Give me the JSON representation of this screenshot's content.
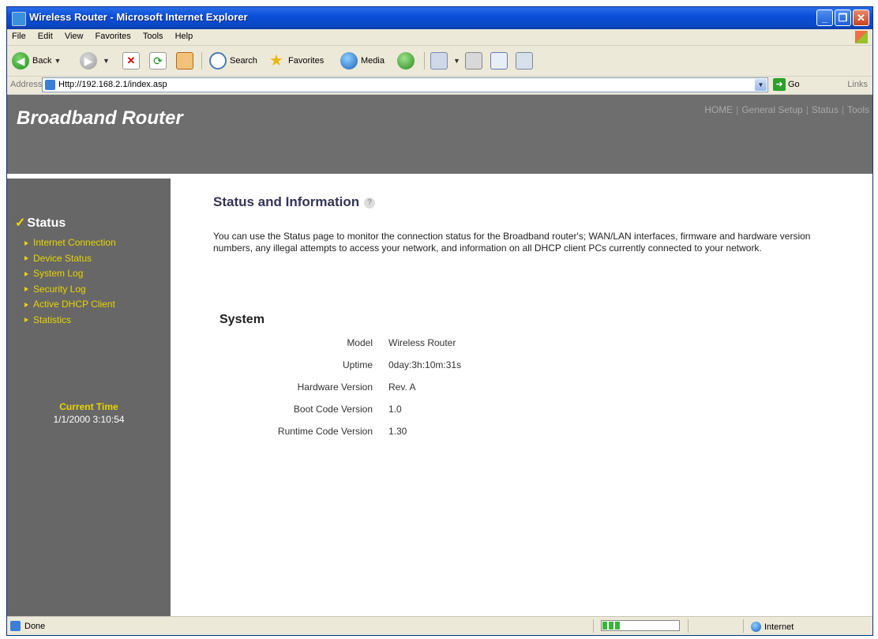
{
  "window": {
    "title": "Wireless Router - Microsoft Internet Explorer"
  },
  "menu": [
    "File",
    "Edit",
    "View",
    "Favorites",
    "Tools",
    "Help"
  ],
  "toolbar": {
    "back": "Back",
    "search": "Search",
    "favorites": "Favorites",
    "media": "Media"
  },
  "address": {
    "label": "Address",
    "url": "Http://192.168.2.1/index.asp",
    "go": "Go",
    "links": "Links"
  },
  "header": {
    "brand": "Broadband Router",
    "nav": [
      "HOME",
      "General Setup",
      "Status",
      "Tools"
    ]
  },
  "sidebar": {
    "heading": "Status",
    "items": [
      "Internet Connection",
      "Device Status",
      "System Log",
      "Security Log",
      "Active DHCP Client",
      "Statistics"
    ],
    "current_time_label": "Current Time",
    "current_time": "1/1/2000 3:10:54"
  },
  "main": {
    "title": "Status and Information",
    "description": "You can use the Status page to monitor the connection status for the Broadband router's; WAN/LAN interfaces, firmware and hardware version numbers, any illegal attempts to access your network, and information on all DHCP client PCs currently connected to your network.",
    "section": "System",
    "rows": [
      {
        "label": "Model",
        "value": "Wireless Router"
      },
      {
        "label": "Uptime",
        "value": "0day:3h:10m:31s"
      },
      {
        "label": "Hardware Version",
        "value": "Rev. A"
      },
      {
        "label": "Boot Code Version",
        "value": "1.0"
      },
      {
        "label": "Runtime Code Version",
        "value": "1.30"
      }
    ]
  },
  "status": {
    "text": "Done",
    "zone": "Internet"
  }
}
